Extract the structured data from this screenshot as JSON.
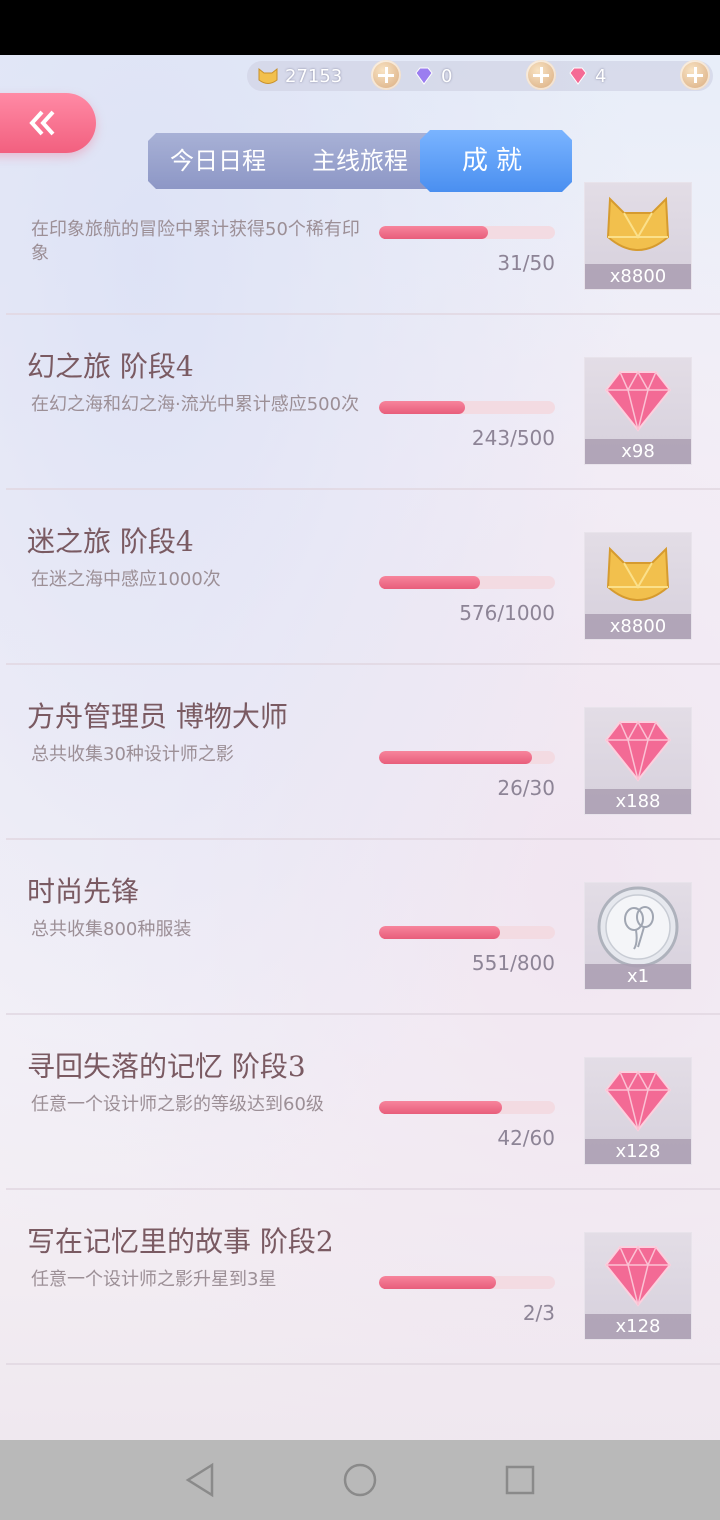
{
  "currency": {
    "gold": "27153",
    "purple_diamond": "0",
    "pink_diamond": "4"
  },
  "tabs": {
    "daily": "今日日程",
    "main": "主线旅程",
    "achievement": "成就"
  },
  "achievements": [
    {
      "title": "",
      "desc": "在印象旅航的冒险中累计获得50个稀有印象",
      "progress": "31/50",
      "ratio": 0.62,
      "reward_type": "gold",
      "reward_qty": "x8800"
    },
    {
      "title": "幻之旅 阶段4",
      "desc": "在幻之海和幻之海·流光中累计感应500次",
      "progress": "243/500",
      "ratio": 0.486,
      "reward_type": "pink-diamond",
      "reward_qty": "x98"
    },
    {
      "title": "迷之旅 阶段4",
      "desc": "在迷之海中感应1000次",
      "progress": "576/1000",
      "ratio": 0.576,
      "reward_type": "gold",
      "reward_qty": "x8800"
    },
    {
      "title": "方舟管理员 博物大师",
      "desc": "总共收集30种设计师之影",
      "progress": "26/30",
      "ratio": 0.867,
      "reward_type": "pink-diamond",
      "reward_qty": "x188"
    },
    {
      "title": "时尚先锋",
      "desc": "总共收集800种服装",
      "progress": "551/800",
      "ratio": 0.689,
      "reward_type": "silver-coin",
      "reward_qty": "x1"
    },
    {
      "title": "寻回失落的记忆 阶段3",
      "desc": "任意一个设计师之影的等级达到60级",
      "progress": "42/60",
      "ratio": 0.7,
      "reward_type": "pink-diamond",
      "reward_qty": "x128"
    },
    {
      "title": "写在记忆里的故事 阶段2",
      "desc": "任意一个设计师之影升星到3星",
      "progress": "2/3",
      "ratio": 0.667,
      "reward_type": "pink-diamond",
      "reward_qty": "x128"
    }
  ]
}
